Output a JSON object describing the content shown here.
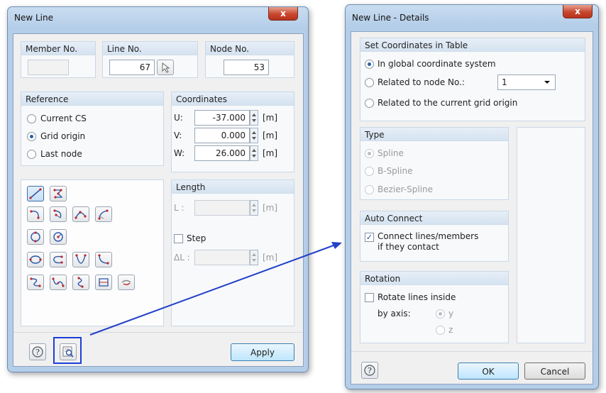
{
  "new_line": {
    "title": "New Line",
    "close": "x",
    "member_no": {
      "label": "Member No.",
      "value": ""
    },
    "line_no": {
      "label": "Line No.",
      "value": "67"
    },
    "node_no": {
      "label": "Node No.",
      "value": "53"
    },
    "reference": {
      "label": "Reference",
      "options": [
        "Current CS",
        "Grid origin",
        "Last node"
      ],
      "selected": 1
    },
    "coordinates": {
      "label": "Coordinates",
      "unit": "[m]",
      "rows": [
        {
          "label": "U:",
          "value": "-37.000"
        },
        {
          "label": "V:",
          "value": "0.000"
        },
        {
          "label": "W:",
          "value": "26.000"
        }
      ]
    },
    "length": {
      "label": "Length",
      "l_label": "L :",
      "unit": "[m]",
      "step_label": "Step",
      "delta_label": "ΔL :"
    },
    "line_types": [
      "polyline-icon",
      "polygon-icon",
      "arc-icon",
      "arc-center-icon",
      "arc-three-point-icon",
      "arc-tangent-icon",
      "circle-icon",
      "circle-center-icon",
      "ellipse-icon",
      "elliptical-arc-icon",
      "parabola-icon",
      "hyperbola-icon",
      "spline-icon",
      "b-spline-icon",
      "nurbs-icon",
      "bezier-icon",
      "cut-line-icon"
    ],
    "apply_label": "Apply"
  },
  "details": {
    "title": "New Line - Details",
    "close": "x",
    "set_coords": {
      "label": "Set Coordinates in Table",
      "options": [
        "In global coordinate system",
        "Related to node No.:",
        "Related to the current grid origin"
      ],
      "selected": 0,
      "node_value": "1"
    },
    "type": {
      "label": "Type",
      "options": [
        "Spline",
        "B-Spline",
        "Bezier-Spline"
      ],
      "selected": 0
    },
    "auto_connect": {
      "label": "Auto Connect",
      "check_line1": "Connect lines/members",
      "check_line2": "if they contact",
      "checked": true
    },
    "rotation": {
      "label": "Rotation",
      "check_label": "Rotate lines inside",
      "axis_label": "by axis:",
      "axes": [
        "y",
        "z"
      ]
    },
    "ok_label": "OK",
    "cancel_label": "Cancel"
  },
  "colors": {
    "highlight": "#1c3fd6",
    "arrow": "#2340c8",
    "accent": "#c1272d"
  }
}
